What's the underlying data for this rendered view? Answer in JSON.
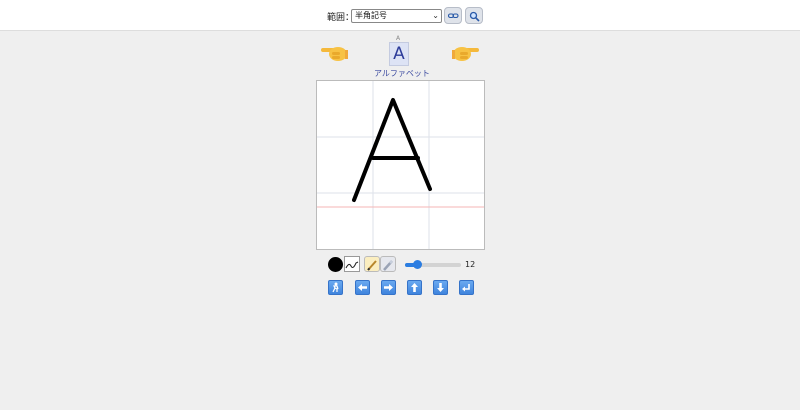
{
  "toolbar": {
    "range_label": "範囲：",
    "range_selected": "半角記号"
  },
  "character": {
    "small": "A",
    "large": "A",
    "name": "アルファベット"
  },
  "pen": {
    "size": "12",
    "size_fraction": 0.15,
    "color": "#000000"
  },
  "colors": {
    "accent": "#2b7de1",
    "guide": "#f2a0a0"
  },
  "icons": {
    "prev_hand": "hand-pointing-left-icon",
    "next_hand": "hand-pointing-right-icon",
    "link": "link-icon",
    "search": "search-icon"
  }
}
